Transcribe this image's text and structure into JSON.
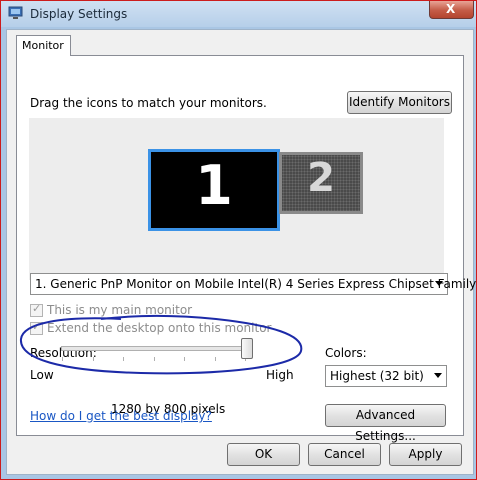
{
  "window": {
    "title": "Display Settings",
    "close_label": "X"
  },
  "tabs": [
    "Monitor"
  ],
  "monitor_tab": {
    "instruction": "Drag the icons to match your monitors.",
    "identify_button": "Identify Monitors",
    "monitors": [
      {
        "number": "1",
        "selected": true
      },
      {
        "number": "2",
        "selected": false
      }
    ],
    "monitor_select": {
      "value": "1. Generic PnP Monitor on Mobile Intel(R) 4 Series Express Chipset Family"
    },
    "main_monitor_checkbox": {
      "label": "This is my main monitor",
      "checked": true,
      "enabled": false
    },
    "extend_checkbox": {
      "label": "Extend the desktop onto this monitor",
      "checked": true,
      "enabled": false
    },
    "resolution": {
      "label": "Resolution:",
      "low_label": "Low",
      "high_label": "High",
      "value_text": "1280 by 800 pixels",
      "slider_level": 1.0
    },
    "colors": {
      "label": "Colors:",
      "value": "Highest (32 bit)"
    },
    "help_link": "How do I get the best display?",
    "advanced_button": "Advanced Settings..."
  },
  "footer": {
    "ok": "OK",
    "cancel": "Cancel",
    "apply": "Apply"
  },
  "colors_theme": {
    "selected_border": "#3b92e6",
    "link": "#1a57c4",
    "annotation_ink": "#1c2aa8",
    "window_frame": "#cc1c1c"
  }
}
